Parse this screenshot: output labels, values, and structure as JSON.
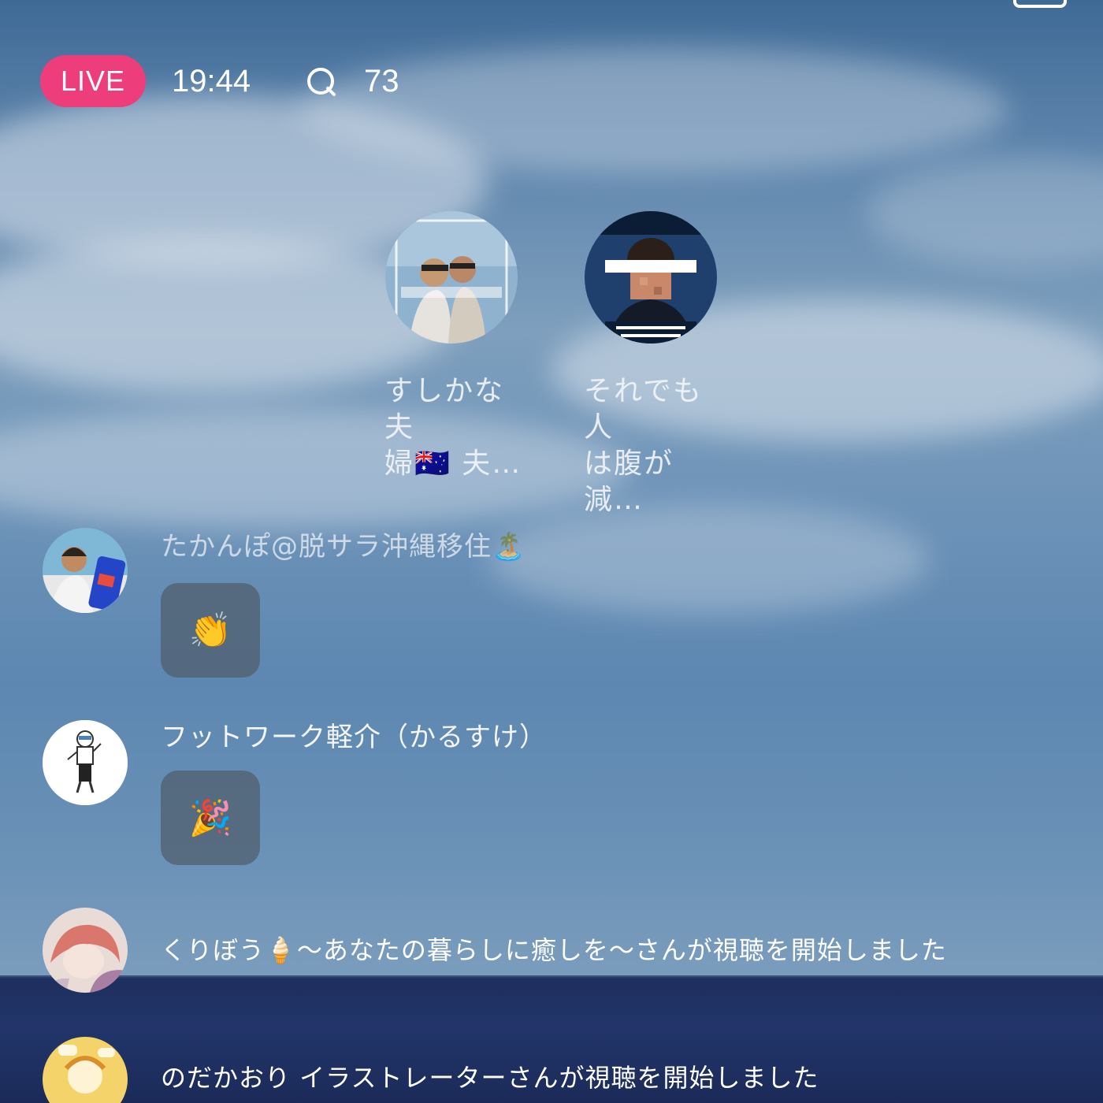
{
  "status": {
    "live_label": "LIVE",
    "time": "19:44",
    "comment_count": "73"
  },
  "channels": [
    {
      "name_line1": "すしかな夫",
      "name_line2": "婦🇦🇺 夫…"
    },
    {
      "name_line1": "それでも人",
      "name_line2": "は腹が減…"
    }
  ],
  "chat": [
    {
      "user": "たかんぽ@脱サラ沖縄移住🏝️",
      "reaction": "👏"
    },
    {
      "user": "フットワーク軽介（かるすけ）",
      "reaction": "🎉"
    },
    {
      "message": "くりぼう🍦～あなたの暮らしに癒しを～さんが視聴を開始しました"
    },
    {
      "message": "のだかおり イラストレーターさんが視聴を開始しました"
    }
  ],
  "colors": {
    "live_badge": "#ee3d7b",
    "text": "#ffffff"
  }
}
